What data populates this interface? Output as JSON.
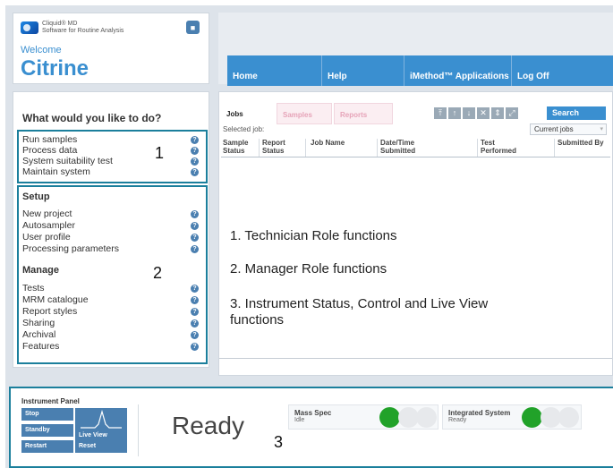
{
  "brand": {
    "line1": "Cliquid® MD",
    "line2": "Software for Routine Analysis"
  },
  "welcome": {
    "label": "Welcome",
    "name": "Citrine"
  },
  "nav": [
    "Home",
    "Help",
    "iMethod™ Applications",
    "Log Off"
  ],
  "menu": {
    "title": "What would you like to do?",
    "technician": [
      "Run samples",
      "Process data",
      "System suitability test",
      "Maintain system"
    ],
    "setup_title": "Setup",
    "setup": [
      "New project",
      "Autosampler",
      "User profile",
      "Processing parameters"
    ],
    "manage_title": "Manage",
    "manage": [
      "Tests",
      "MRM catalogue",
      "Report styles",
      "Sharing",
      "Archival",
      "Features"
    ],
    "help_glyph": "?"
  },
  "callouts": {
    "one": "1",
    "two": "2",
    "three": "3"
  },
  "jobs": {
    "tabs": [
      "Jobs",
      "Samples",
      "Reports"
    ],
    "tools": [
      "⤒",
      "↑",
      "↓",
      "✕",
      "⇕",
      "⤢"
    ],
    "search": "Search",
    "selected_job": "Selected job:",
    "filter": "Current jobs",
    "columns": [
      {
        "l1": "Sample",
        "l2": "Status"
      },
      {
        "l1": "Report",
        "l2": "Status"
      },
      {
        "l1": "",
        "l2": "Job Name"
      },
      {
        "l1": "Date/Time",
        "l2": "Submitted"
      },
      {
        "l1": "Test",
        "l2": "Performed"
      },
      {
        "l1": "",
        "l2": "Submitted By"
      }
    ]
  },
  "functions": [
    "1. Technician Role functions",
    "2. Manager Role functions",
    "3. Instrument Status, Control  and Live View",
    "functions"
  ],
  "instrument": {
    "title": "Instrument Panel",
    "buttons": {
      "stop": "Stop",
      "standby": "Standby",
      "restart": "Restart",
      "reset": "Reset",
      "liveview": "Live View"
    },
    "state": "Ready",
    "mass_spec": {
      "name": "Mass Spec",
      "status": "Idle"
    },
    "integrated": {
      "name": "Integrated System",
      "status": "Ready"
    }
  },
  "colors": {
    "accent": "#3a8fd0",
    "callout_border": "#1b7f9c",
    "status_green": "#21a229"
  },
  "icons": {
    "lock": "lock-icon",
    "help": "help-icon",
    "liveview": "waveform-icon"
  }
}
